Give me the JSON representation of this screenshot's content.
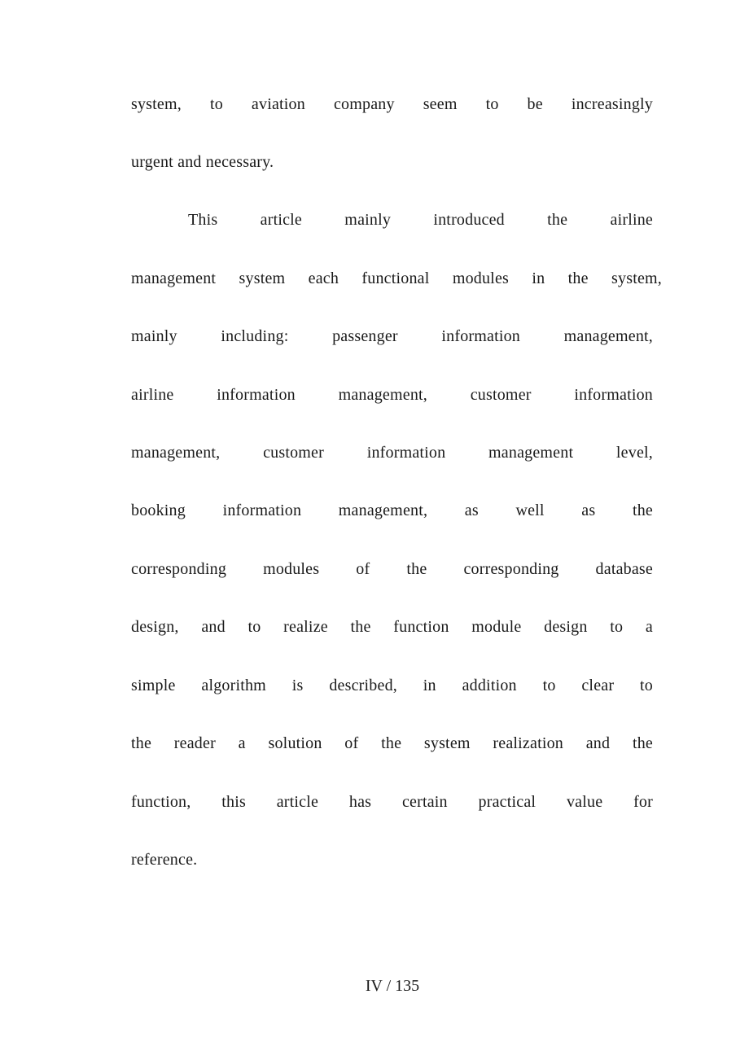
{
  "document": {
    "paragraphs": [
      {
        "lines": [
          "system, to aviation company seem to be increasingly",
          "urgent and necessary."
        ]
      },
      {
        "lines": [
          "This article mainly introduced the airline",
          "management system each functional modules in the system,",
          "mainly including: passenger information management,",
          "airline information management, customer information",
          "management, customer information management level,",
          "booking information management, as well as the",
          "corresponding modules of the corresponding database",
          "design, and to realize the function module design to a",
          "simple algorithm is described, in addition to clear to",
          "the reader a solution of the system realization and the",
          "function, this article has certain practical value for",
          "reference."
        ]
      }
    ],
    "footer": {
      "page_label": "IV / 135"
    }
  }
}
